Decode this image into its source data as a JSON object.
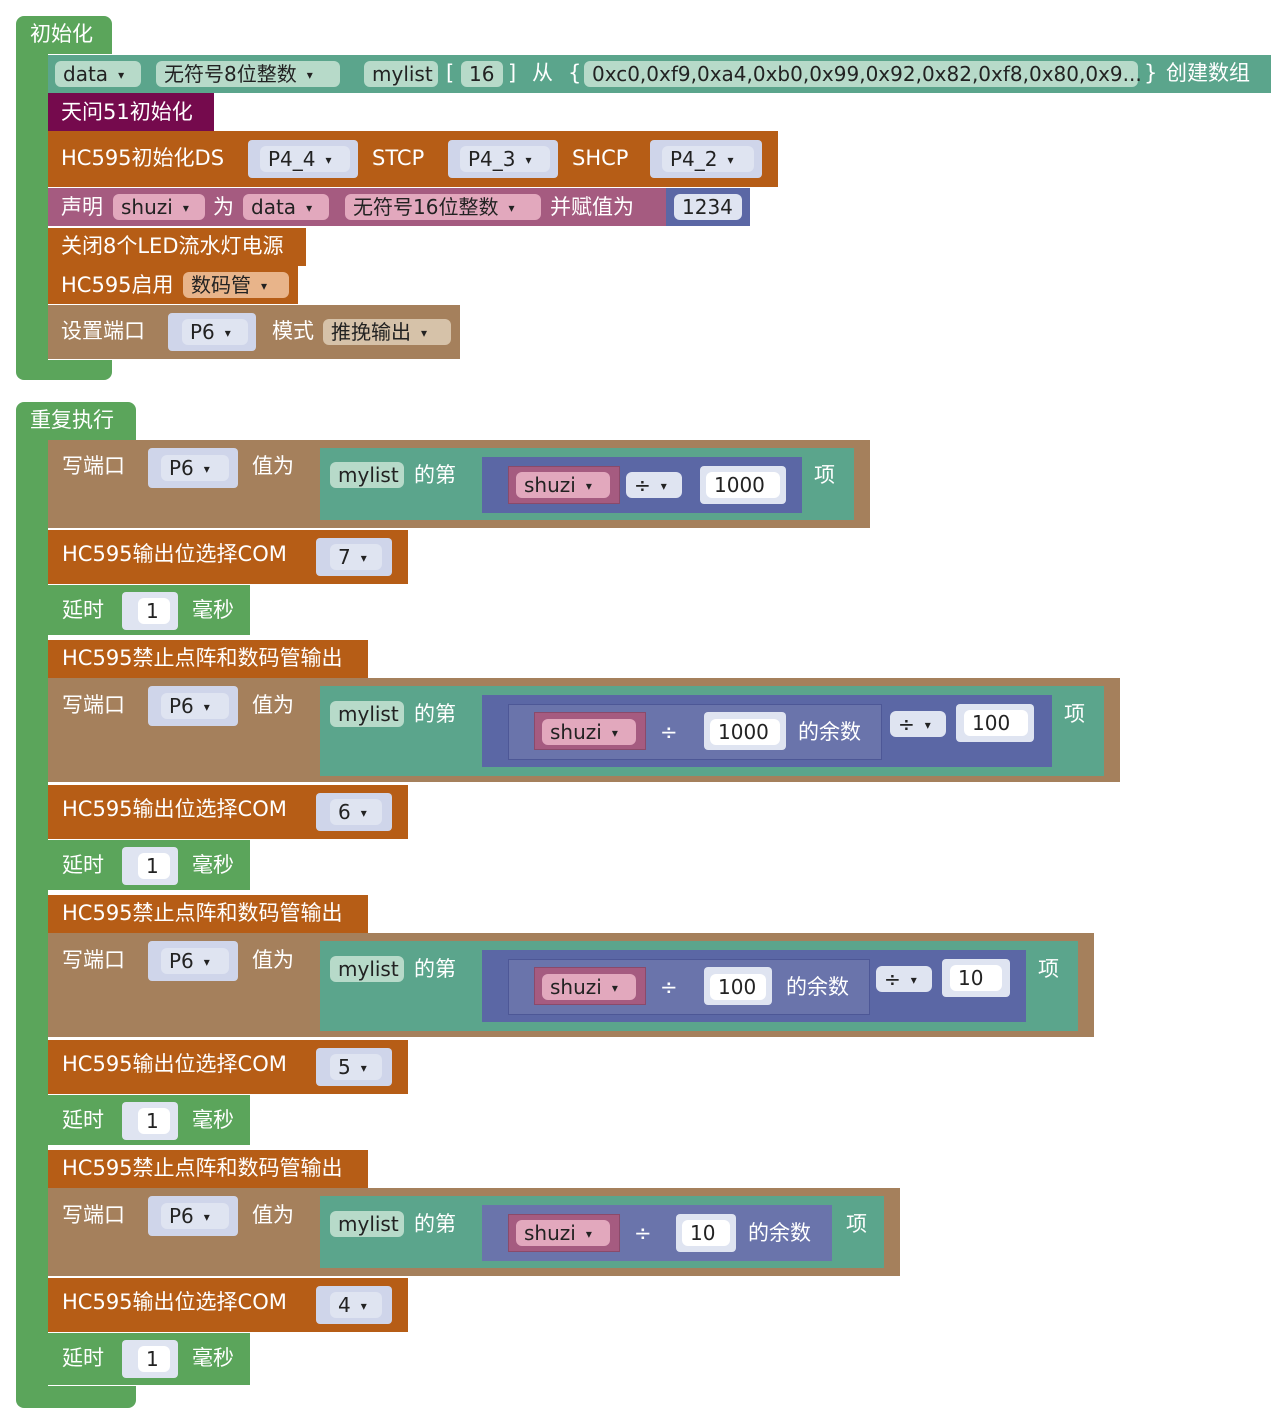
{
  "init": {
    "hat": "初始化",
    "array_row": {
      "type_kw": "data",
      "dtype": "无符号8位整数",
      "name": "mylist",
      "lb": "[",
      "size": "16",
      "rb": "]",
      "from": "从",
      "lbrace": "{",
      "values": "0xc0,0xf9,0xa4,0xb0,0x99,0x92,0x82,0xf8,0x80,0x9...",
      "rbrace": "}",
      "create": "创建数组"
    },
    "tianwen": "天问51初始化",
    "hc595_init": {
      "label": "HC595初始化DS",
      "ds": "P4_4",
      "stcp_label": "STCP",
      "stcp": "P4_3",
      "shcp_label": "SHCP",
      "shcp": "P4_2"
    },
    "declare": {
      "label": "声明",
      "var": "shuzi",
      "as": "为",
      "kw": "data",
      "dtype": "无符号16位整数",
      "assign": "并赋值为",
      "value": "1234"
    },
    "close_led": "关闭8个LED流水灯电源",
    "hc595_enable": {
      "label": "HC595启用",
      "option": "数码管"
    },
    "set_port": {
      "label": "设置端口",
      "port": "P6",
      "mode_label": "模式",
      "mode": "推挽输出"
    }
  },
  "loop": {
    "hat": "重复执行",
    "write_label": "写端口",
    "port": "P6",
    "value_label": "值为",
    "list": "mylist",
    "index_of": "的第",
    "item": "项",
    "var": "shuzi",
    "div": "÷",
    "mod": "的余数",
    "com_label": "HC595输出位选择COM",
    "delay_label": "延时",
    "delay_value": "1",
    "delay_unit": "毫秒",
    "disable": "HC595禁止点阵和数码管输出",
    "groups": [
      {
        "div1": "1000",
        "com": "7"
      },
      {
        "div1": "1000",
        "div2": "100",
        "com": "6"
      },
      {
        "div1": "100",
        "div2": "10",
        "com": "5"
      },
      {
        "div1": "10",
        "com": "4"
      }
    ]
  }
}
